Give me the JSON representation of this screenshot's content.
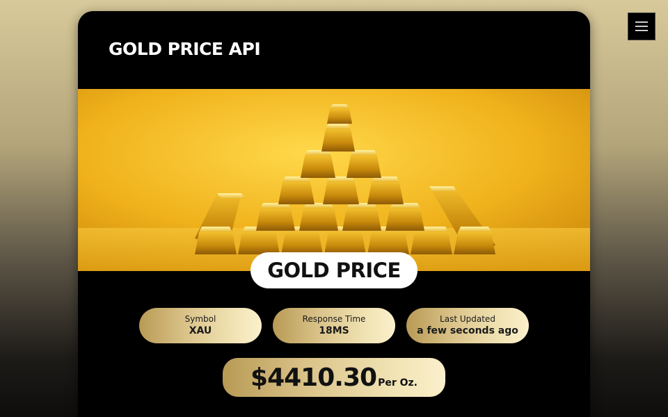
{
  "app": {
    "title": "GOLD PRICE API"
  },
  "hero": {
    "image_alt": "Pyramid of stacked gold bars on a golden background"
  },
  "section": {
    "title": "GOLD PRICE"
  },
  "stats": [
    {
      "label": "Symbol",
      "value": "XAU"
    },
    {
      "label": "Response Time",
      "value": "18MS"
    },
    {
      "label": "Last Updated",
      "value": "a few seconds ago"
    }
  ],
  "price": {
    "value": "$4410.30",
    "unit": "Per Oz."
  },
  "icons": {
    "menu": "hamburger-menu-icon"
  },
  "colors": {
    "card_background": "#000000",
    "accent_gold_start": "#b89a55",
    "accent_gold_end": "#fbf0cc",
    "hero_background": "#f2b51f"
  }
}
